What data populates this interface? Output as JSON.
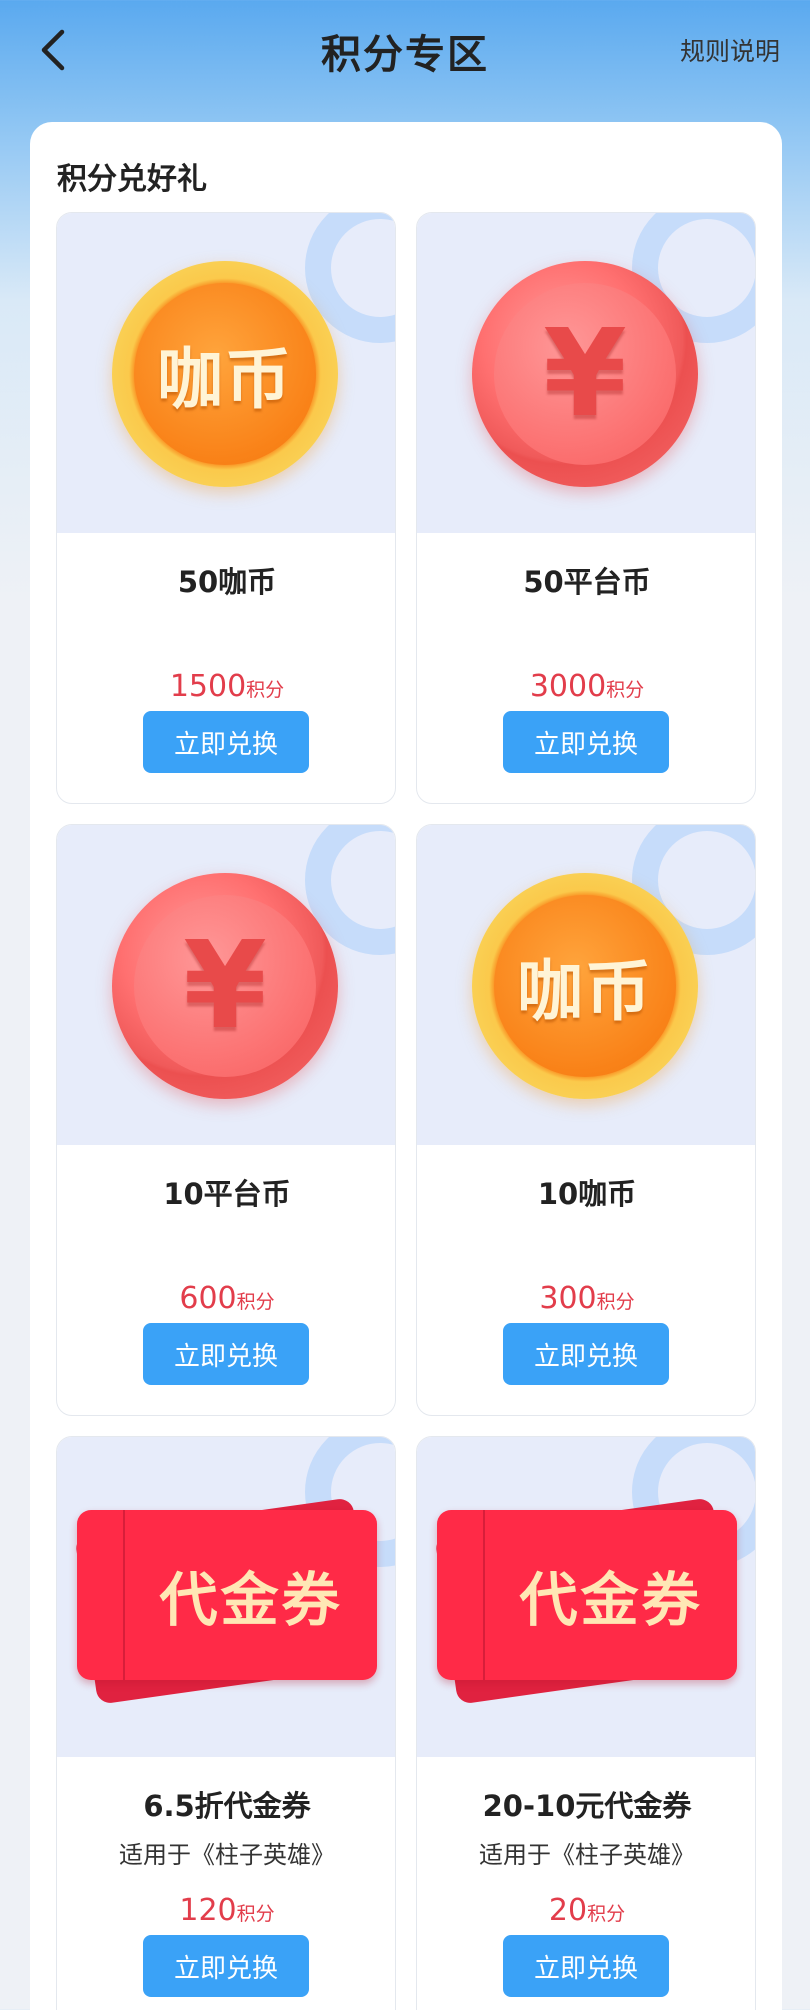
{
  "header": {
    "title": "积分专区",
    "rules_label": "规则说明",
    "back_icon": "chevron-left-icon"
  },
  "section": {
    "title": "积分兑好礼"
  },
  "products": [
    {
      "name": "50咖币",
      "subtitle": "",
      "points": "1500",
      "unit": "积分",
      "button": "立即兑换",
      "image": "coffee-coin",
      "image_text": "咖币"
    },
    {
      "name": "50平台币",
      "subtitle": "",
      "points": "3000",
      "unit": "积分",
      "button": "立即兑换",
      "image": "platform-coin",
      "image_text": "¥"
    },
    {
      "name": "10平台币",
      "subtitle": "",
      "points": "600",
      "unit": "积分",
      "button": "立即兑换",
      "image": "platform-coin",
      "image_text": "¥"
    },
    {
      "name": "10咖币",
      "subtitle": "",
      "points": "300",
      "unit": "积分",
      "button": "立即兑换",
      "image": "coffee-coin",
      "image_text": "咖币"
    },
    {
      "name": "6.5折代金券",
      "subtitle": "适用于《柱子英雄》",
      "points": "120",
      "unit": "积分",
      "button": "立即兑换",
      "image": "voucher",
      "image_text": "代金券"
    },
    {
      "name": "20-10元代金券",
      "subtitle": "适用于《柱子英雄》",
      "points": "20",
      "unit": "积分",
      "button": "立即兑换",
      "image": "voucher",
      "image_text": "代金券"
    }
  ],
  "colors": {
    "header_blue": "#5aa9ef",
    "button_blue": "#3aa2f7",
    "price_red": "#e23d4b",
    "card_image_bg": "#e7ecfa"
  }
}
